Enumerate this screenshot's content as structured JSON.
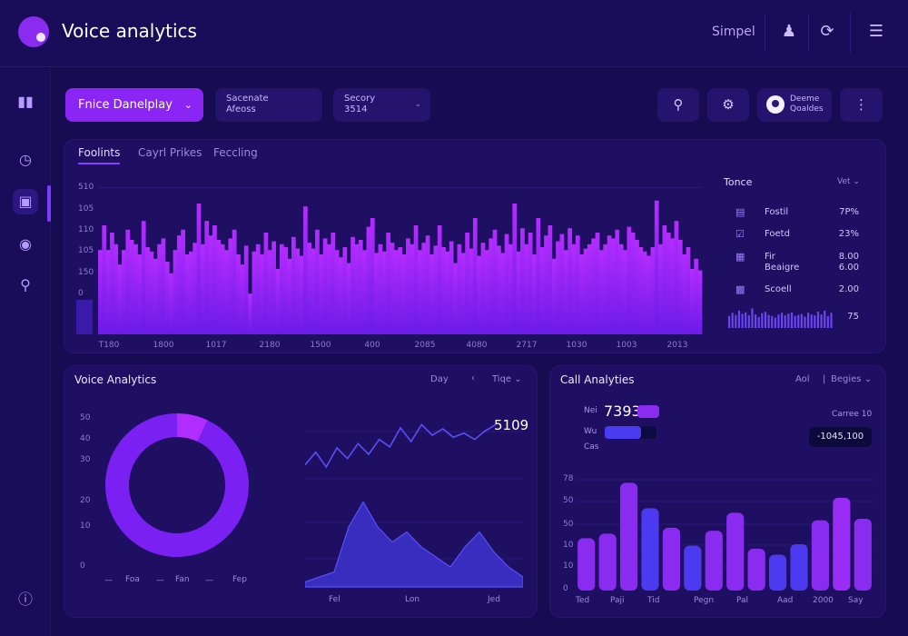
{
  "header": {
    "title": "Voice analytics",
    "user_label": "Simpel"
  },
  "toolbar": {
    "primary_dropdown": "Fnice Danelplay",
    "dropdown_2": {
      "line1": "Sacenate",
      "line2": "Afeoss"
    },
    "dropdown_3": {
      "line1": "Secory",
      "line2": "3514"
    },
    "user_chip": {
      "line1": "Deeme",
      "line2": "Qoaldes"
    }
  },
  "top_chart": {
    "tabs": [
      "Foolints",
      "Cayrl Prikes",
      "Feccling"
    ],
    "y_ticks": [
      "510",
      "105",
      "110",
      "105",
      "150",
      "0"
    ],
    "x_ticks": [
      "T180",
      "1800",
      "1017",
      "2180",
      "1500",
      "400",
      "2085",
      "4080",
      "2717",
      "1030",
      "1003",
      "2013"
    ],
    "bars": [
      58,
      75,
      58,
      70,
      62,
      48,
      58,
      72,
      65,
      62,
      55,
      78,
      60,
      57,
      52,
      62,
      66,
      50,
      42,
      58,
      68,
      72,
      55,
      57,
      63,
      90,
      62,
      78,
      68,
      75,
      65,
      62,
      58,
      66,
      72,
      55,
      48,
      61,
      28,
      57,
      62,
      55,
      70,
      58,
      64,
      45,
      62,
      60,
      52,
      67,
      59,
      54,
      88,
      63,
      59,
      72,
      55,
      66,
      62,
      70,
      58,
      53,
      60,
      49,
      67,
      62,
      65,
      58,
      74,
      80,
      56,
      62,
      57,
      70,
      63,
      58,
      60,
      55,
      66,
      62,
      75,
      58,
      63,
      68,
      55,
      61,
      75,
      60,
      57,
      64,
      49,
      62,
      56,
      70,
      59,
      80,
      54,
      63,
      58,
      66,
      72,
      61,
      56,
      69,
      62,
      90,
      57,
      73,
      62,
      70,
      55,
      80,
      60,
      68,
      75,
      52,
      64,
      69,
      58,
      73,
      62,
      68,
      55,
      59,
      62,
      66,
      70,
      58,
      62,
      68,
      66,
      72,
      62,
      58,
      74,
      70,
      65,
      60,
      57,
      54,
      60,
      92,
      62,
      75,
      70,
      66,
      78,
      65,
      55,
      60,
      45,
      52,
      44
    ]
  },
  "legend": {
    "title": "Tonce",
    "dropdown": "Vet",
    "items": [
      {
        "icon": "document-icon",
        "label": "Fostil",
        "value": "7P%"
      },
      {
        "icon": "check-square-icon",
        "label": "Foetd",
        "value": "23%"
      },
      {
        "icon": "list-icon",
        "label": "Fir Beaigre",
        "value": "8.00 6.00"
      },
      {
        "icon": "stack-icon",
        "label": "Scoell",
        "value": "2.00"
      }
    ],
    "mini_value": "75",
    "mini_bars": [
      55,
      70,
      60,
      80,
      65,
      72,
      58,
      90,
      62,
      50,
      68,
      74,
      60,
      55,
      48,
      62,
      70,
      58,
      66,
      72,
      55,
      60,
      64,
      52,
      70,
      62,
      58,
      75,
      62,
      80,
      55,
      70
    ]
  },
  "voice_card": {
    "title": "Voice Analytics",
    "controls": [
      "Day",
      "Tiqe"
    ],
    "y_ticks": [
      "50",
      "40",
      "30",
      "20",
      "10",
      "0"
    ],
    "donut_x_ticks": [
      "Foa",
      "Fan",
      "Fep"
    ],
    "line_value": "5109",
    "area_x_ticks": [
      "Fel",
      "Lon",
      "Jed"
    ],
    "donut": [
      {
        "value": 7
      },
      {
        "value": 93
      }
    ]
  },
  "call_card": {
    "title": "Call Analyties",
    "controls": [
      "Aol",
      "Begies"
    ],
    "kpi_value": "7393",
    "kpi_labels": [
      "Nei",
      "Wu",
      "Cas"
    ],
    "progress": [
      0.45,
      0.7
    ],
    "right_label": "Carree 10",
    "badge": "-1045,100",
    "y_ticks": [
      "78",
      "50",
      "50",
      "10",
      "10",
      "0"
    ],
    "x_ticks": [
      "Ted",
      "Paji",
      "Tid",
      "Pegn",
      "Pal",
      "Aad",
      "2000",
      "Say"
    ]
  },
  "chart_data": [
    {
      "type": "bar",
      "title": "",
      "y_ticks": [
        "510",
        "105",
        "110",
        "105",
        "150",
        "0"
      ],
      "categories": [
        "T180",
        "1800",
        "1017",
        "2180",
        "1500",
        "400",
        "2085",
        "4080",
        "2717",
        "1030",
        "1003",
        "2013"
      ]
    },
    {
      "type": "pie",
      "values": [
        7,
        93
      ],
      "y_ticks": [
        "50",
        "40",
        "30",
        "20",
        "10",
        "0"
      ],
      "x_ticks": [
        "Foa",
        "Fan",
        "Fep"
      ]
    },
    {
      "type": "line",
      "series": [
        {
          "values": [
            20,
            32,
            18,
            36,
            26,
            40,
            30,
            44,
            37,
            55,
            42,
            58,
            48,
            54,
            46,
            50,
            44,
            52,
            58
          ]
        },
        {
          "values": [
            5,
            10,
            15,
            60,
            85,
            60,
            45,
            55,
            40,
            30,
            20,
            40,
            55,
            35,
            20,
            10
          ]
        }
      ],
      "value_label": "5109",
      "x_ticks": [
        "Fel",
        "Lon",
        "Jed"
      ]
    },
    {
      "type": "bar",
      "title": "Call Analyties",
      "categories": [
        "Ted",
        "Paji",
        "Tid",
        "Pegn",
        "Pal",
        "Aad",
        "2000",
        "Say"
      ],
      "series": [
        {
          "values": [
            35,
            38,
            72,
            55,
            42,
            30,
            40,
            52,
            28,
            24,
            31,
            47,
            62,
            48
          ]
        }
      ],
      "y_ticks": [
        "78",
        "50",
        "50",
        "10",
        "10",
        "0"
      ],
      "ylim": [
        0,
        85
      ]
    }
  ]
}
